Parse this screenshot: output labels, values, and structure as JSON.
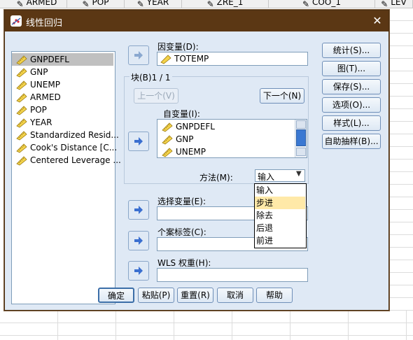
{
  "spreadsheet": {
    "columns": [
      "ARMED",
      "POP",
      "YEAR",
      "ZRE_1",
      "COO_1",
      "LEV"
    ]
  },
  "dialog": {
    "title": "线性回归",
    "source_variables": [
      "GNPDEFL",
      "GNP",
      "UNEMP",
      "ARMED",
      "POP",
      "YEAR",
      "Standardized Resid...",
      "Cook's Distance [C...",
      "Centered Leverage ..."
    ],
    "dependent_label": "因变量(D):",
    "dependent_value": "TOTEMP",
    "block_label": "块(B)1 / 1",
    "prev_button": "上一个(V)",
    "next_button": "下一个(N)",
    "independent_label": "自变量(I):",
    "independent_variables": [
      "GNPDEFL",
      "GNP",
      "UNEMP"
    ],
    "method_label": "方法(M):",
    "method_value": "输入",
    "method_options": [
      "输入",
      "步进",
      "除去",
      "后退",
      "前进"
    ],
    "selection_label": "选择变量(E):",
    "case_label": "个案标签(C):",
    "wls_label": "WLS 权重(H):",
    "side_buttons": [
      "统计(S)...",
      "图(T)...",
      "保存(S)...",
      "选项(O)...",
      "样式(L)...",
      "自助抽样(B)..."
    ],
    "bottom_buttons": [
      "确定",
      "粘贴(P)",
      "重置(R)",
      "取消",
      "帮助"
    ]
  }
}
